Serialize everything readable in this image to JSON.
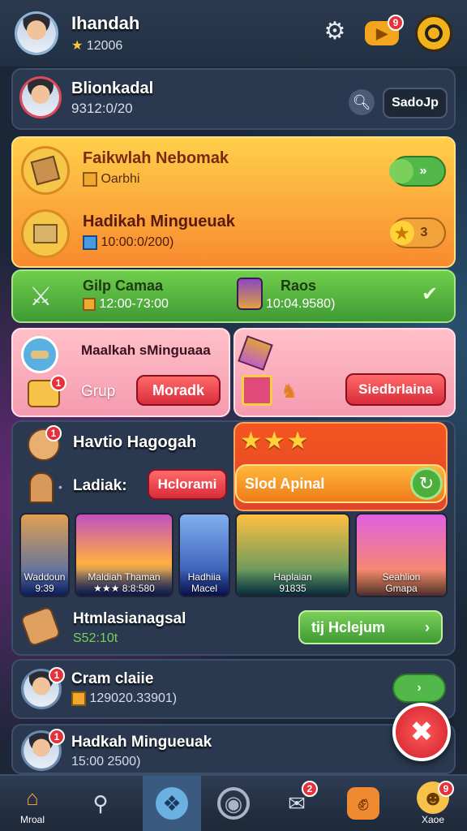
{
  "header": {
    "player_name": "Ihandah",
    "player_stars": "12006",
    "star_glyph": "★",
    "notif_count": "9"
  },
  "profile_row": {
    "name": "Blionkadal",
    "sub": "9312:0/20",
    "button": "SadoJp"
  },
  "quests": [
    {
      "title": "Faikwlah Nebomak",
      "sub": "Oarbhi",
      "badge": "»"
    },
    {
      "title": "Hadikah Mingueuak",
      "sub": "10:00:0/200)",
      "badge": "3"
    }
  ],
  "green_bar": {
    "title": "Gilp Camaa",
    "sub": "12:00-73:00",
    "right_title": "Raos",
    "right_sub": "10:04.9580)"
  },
  "pink_left": {
    "title": "Maalkah sMinguaaa",
    "label": "Grup",
    "button": "Moradk",
    "badge": "1"
  },
  "pink_right": {
    "button": "Siedbrlaina"
  },
  "dark_section": {
    "title": "Havtio Hagogah",
    "badge": "1",
    "ladiak_label": "Ladiak:",
    "ladiak_button": "Hclorami",
    "special_button": "Slod Apinal"
  },
  "cards": [
    {
      "line1": "Waddoun",
      "line2": "9:39"
    },
    {
      "line1": "Maldiah Thaman",
      "line2": "★★★  8:8:580"
    },
    {
      "line1": "Hadhiia",
      "line2": "Macel"
    },
    {
      "line1": "Haplaian",
      "line2": "91835"
    },
    {
      "line1": "Seahlion",
      "line2": "Gmapa"
    }
  ],
  "promo": {
    "title": "Htmlasianagsal",
    "sub": "S52:10t",
    "button": "tij Hclejum"
  },
  "list_items": [
    {
      "title": "Cram claiie",
      "sub": "129020.33901)",
      "badge": "1"
    },
    {
      "title": "Hadkah Mingueuak",
      "sub": "15:00 2500)",
      "badge": "1"
    }
  ],
  "nav": [
    {
      "label": "Mroal",
      "icon": "home-icon"
    },
    {
      "label": "",
      "icon": "search-icon"
    },
    {
      "label": "",
      "icon": "pet-icon"
    },
    {
      "label": "",
      "icon": "target-icon"
    },
    {
      "label": "",
      "icon": "chat-icon",
      "badge": "2"
    },
    {
      "label": "",
      "icon": "fist-icon"
    },
    {
      "label": "Xaoe",
      "icon": "mascot-icon",
      "badge": "9"
    }
  ],
  "colors": {
    "accent_red": "#e5313b",
    "accent_green": "#4caf3c",
    "accent_orange": "#f7882a",
    "panel_dark": "#2a3950"
  }
}
